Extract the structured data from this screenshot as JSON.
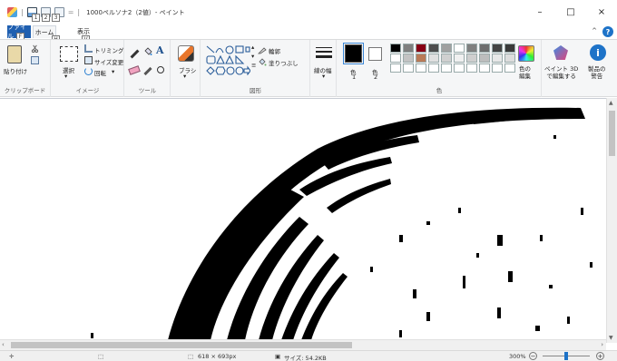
{
  "titlebar": {
    "title": "1000ペルソナ2（2値）- ペイント",
    "qa_separator": "=",
    "minimize": "–",
    "maximize": "□",
    "close": "×"
  },
  "tabs": {
    "file": "ファイル",
    "home": "ホーム",
    "view": "表示",
    "home_keytip": "H",
    "view_keytip": "V",
    "file_keytip": "F",
    "qa_keytips": [
      "1",
      "2",
      "3"
    ],
    "collapse": "^",
    "help": "?"
  },
  "ribbon": {
    "clipboard": {
      "label": "クリップボード",
      "paste": "貼り付け"
    },
    "image": {
      "label": "イメージ",
      "select": "選択",
      "crop": "トリミング",
      "resize": "サイズ変更",
      "rotate": "回転"
    },
    "tools": {
      "label": "ツール"
    },
    "brushes": {
      "label": "ブラシ"
    },
    "shapes": {
      "label": "図形",
      "outline": "輪郭",
      "fill": "塗りつぶし"
    },
    "size": {
      "label": "線の幅"
    },
    "colors": {
      "label": "色",
      "color1": "色",
      "color1_sub": "1",
      "color2": "色",
      "color2_sub": "2",
      "edit": "色の\n編集",
      "palette": [
        "#000000",
        "#7f7f7f",
        "#880015",
        "#4d4d4d",
        "#a0a0a0",
        "#ffffff",
        "#7f7f7f",
        "#6d6d6d",
        "#444444",
        "#3a3a3a",
        "#ffffff",
        "#c3c3c3",
        "#b97a57",
        "#e0e0e0",
        "#d0d0d0",
        "#f0f0f0",
        "#cfcfcf",
        "#bdbdbd",
        "#e8e8e8",
        "#dddddd",
        "#ffffff",
        "#ffffff",
        "#ffffff",
        "#ffffff",
        "#ffffff",
        "#ffffff",
        "#ffffff",
        "#ffffff",
        "#ffffff",
        "#ffffff"
      ]
    },
    "paint3d": {
      "label": "ペイント 3D\nで編集する"
    },
    "product_alert": {
      "label": "製品の\n警告"
    }
  },
  "status": {
    "dimensions": "618 × 693px",
    "size": "サイズ: 54.2KB",
    "zoom": "300%",
    "zoom_minus": "−",
    "zoom_plus": "+",
    "zoom_level": 0.5
  },
  "colors": {
    "accent": "#1f5fb0",
    "ribbon_bg": "#f5f6f7",
    "statusbar_bg": "#f0f0f0"
  }
}
